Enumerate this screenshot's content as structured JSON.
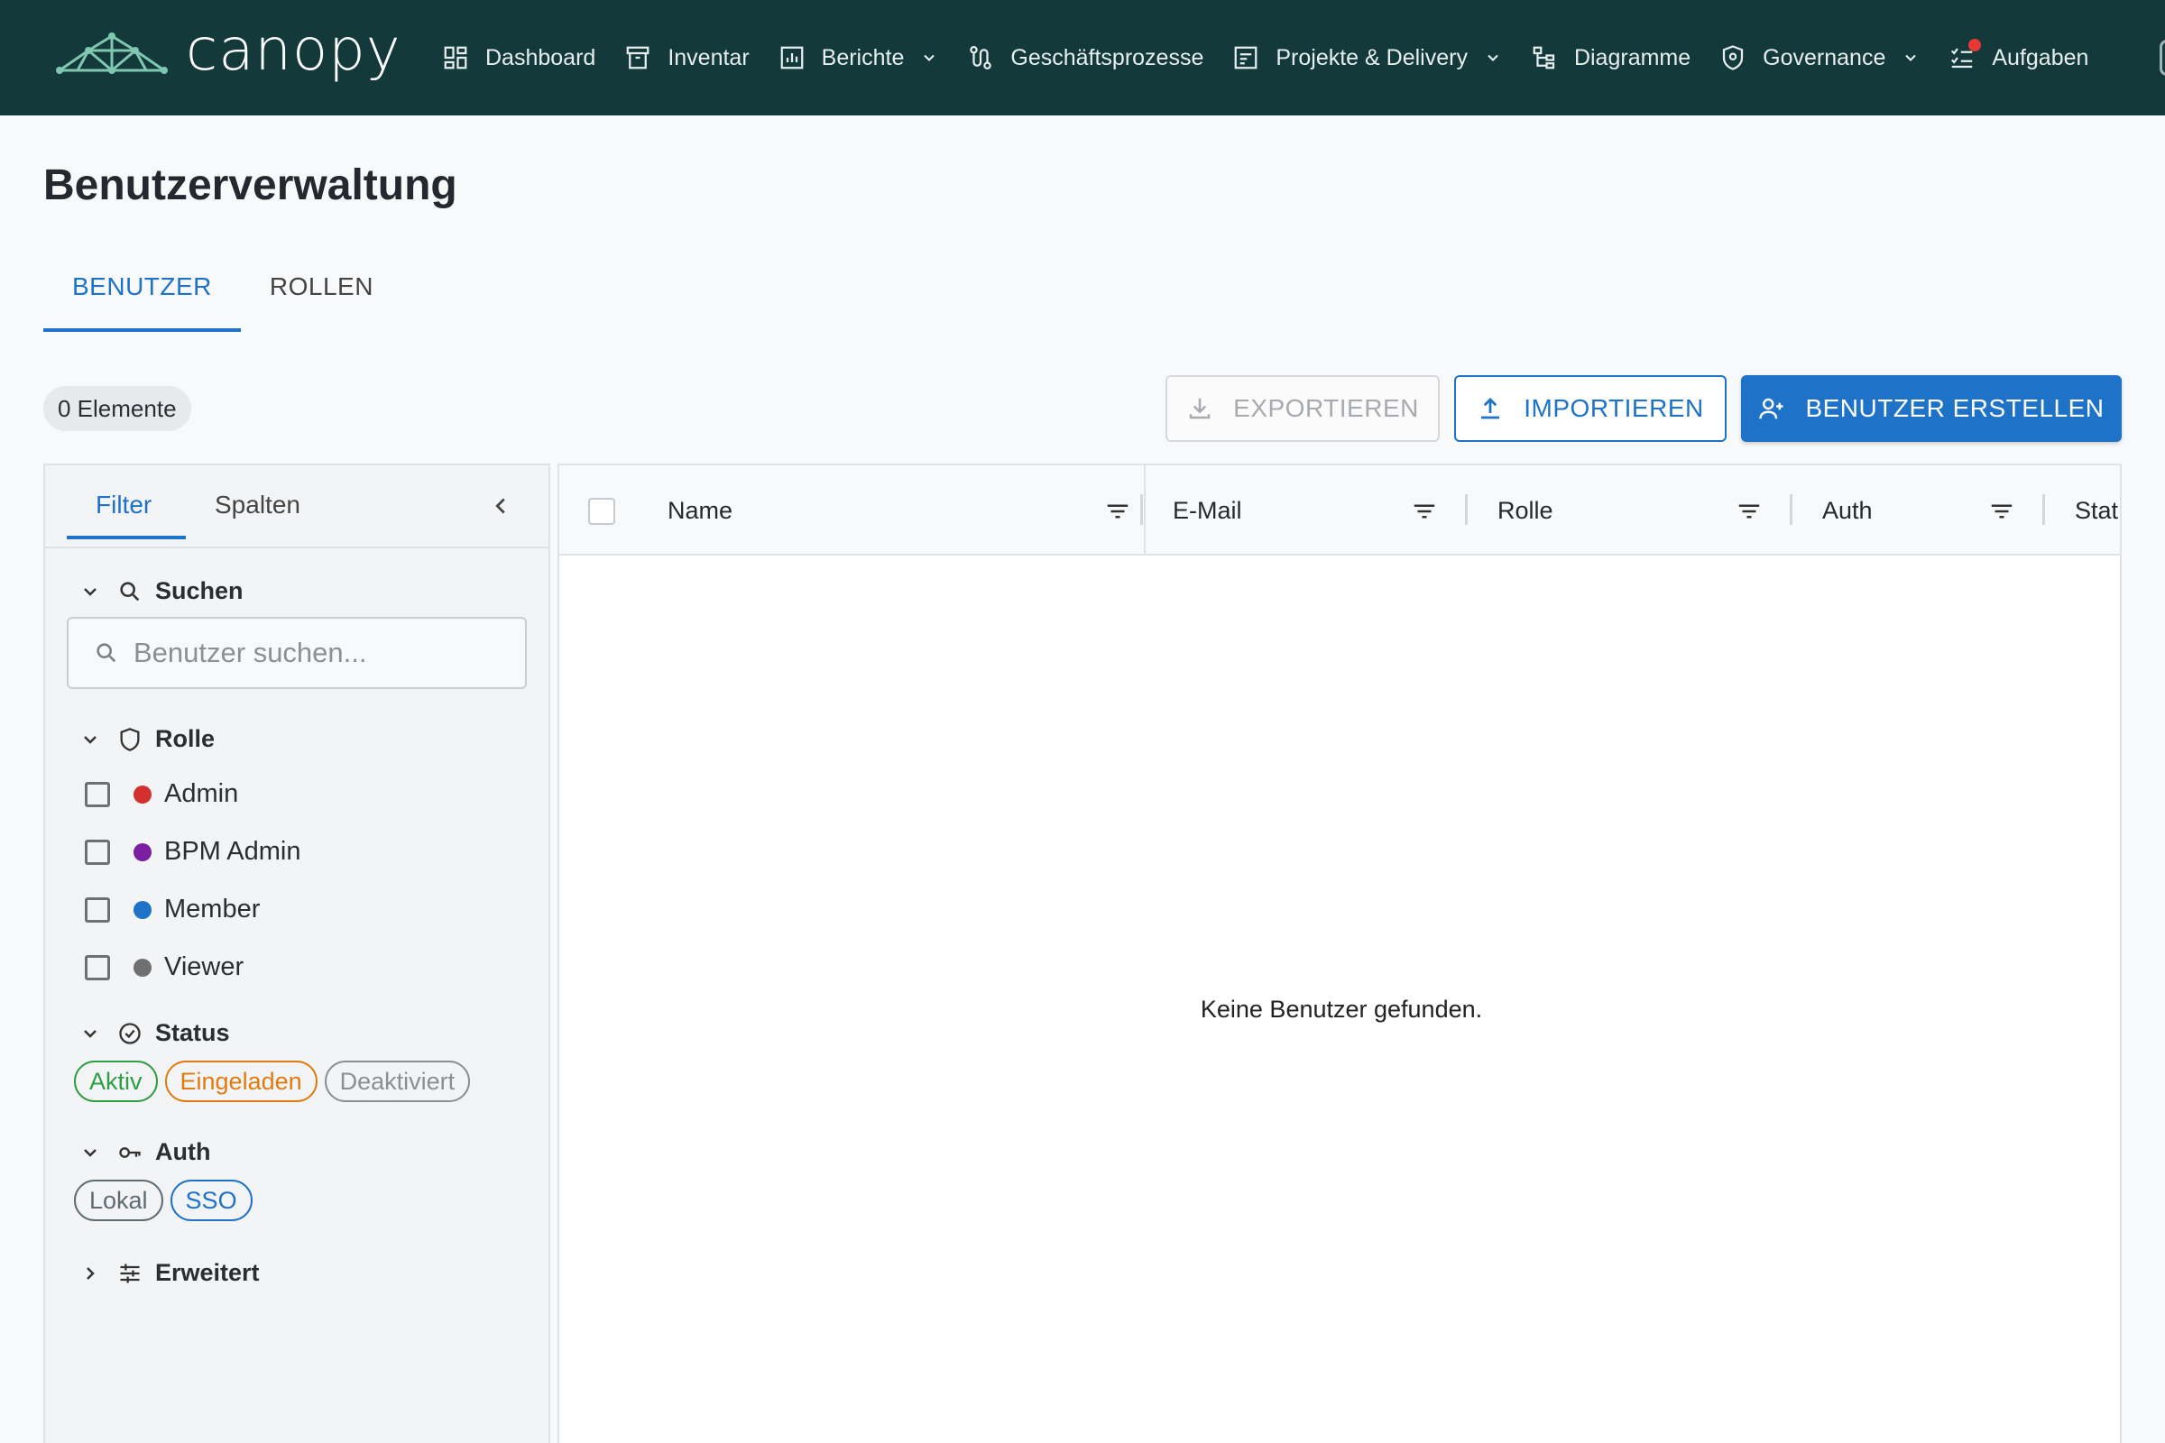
{
  "app": {
    "logo_text": "canopy"
  },
  "nav": [
    {
      "label": "Dashboard",
      "icon": "dashboard-icon",
      "dropdown": false
    },
    {
      "label": "Inventar",
      "icon": "archive-icon",
      "dropdown": false
    },
    {
      "label": "Berichte",
      "icon": "bar-chart-icon",
      "dropdown": true
    },
    {
      "label": "Geschäftsprozesse",
      "icon": "route-icon",
      "dropdown": false
    },
    {
      "label": "Projekte & Delivery",
      "icon": "project-icon",
      "dropdown": true
    },
    {
      "label": "Diagramme",
      "icon": "hierarchy-icon",
      "dropdown": false
    },
    {
      "label": "Governance",
      "icon": "shield-icon",
      "dropdown": true
    },
    {
      "label": "Aufgaben",
      "icon": "checklist-icon",
      "dropdown": false,
      "notification": true
    }
  ],
  "page": {
    "title": "Benutzerverwaltung"
  },
  "tabs": [
    {
      "label": "BENUTZER",
      "active": true
    },
    {
      "label": "ROLLEN",
      "active": false
    }
  ],
  "toolbar": {
    "count": "0 Elemente",
    "export_label": "EXPORTIEREN",
    "import_label": "IMPORTIEREN",
    "create_label": "BENUTZER ERSTELLEN"
  },
  "side_panel": {
    "tabs": [
      {
        "label": "Filter",
        "active": true
      },
      {
        "label": "Spalten",
        "active": false
      }
    ],
    "search": {
      "title": "Suchen",
      "placeholder": "Benutzer suchen...",
      "value": ""
    },
    "role": {
      "title": "Rolle",
      "items": [
        {
          "label": "Admin",
          "color": "#d32f2f",
          "checked": false
        },
        {
          "label": "BPM Admin",
          "color": "#7b1fa2",
          "checked": false
        },
        {
          "label": "Member",
          "color": "#1e72c8",
          "checked": false
        },
        {
          "label": "Viewer",
          "color": "#707070",
          "checked": false
        }
      ]
    },
    "status": {
      "title": "Status",
      "chips": [
        {
          "label": "Aktiv",
          "color": "#2e9e44"
        },
        {
          "label": "Eingeladen",
          "color": "#e07b12"
        },
        {
          "label": "Deaktiviert",
          "color": "#8a8f94"
        }
      ]
    },
    "auth": {
      "title": "Auth",
      "chips": [
        {
          "label": "Lokal",
          "color": "#5e6b73"
        },
        {
          "label": "SSO",
          "color": "#1e72c8"
        }
      ]
    },
    "advanced": {
      "title": "Erweitert",
      "expanded": false
    }
  },
  "grid": {
    "columns": [
      "Name",
      "E-Mail",
      "Rolle",
      "Auth",
      "Stat"
    ],
    "rows": [],
    "empty_text": "Keine Benutzer gefunden."
  },
  "colors": {
    "nav_bg": "#13393a",
    "accent": "#1e72c8"
  }
}
